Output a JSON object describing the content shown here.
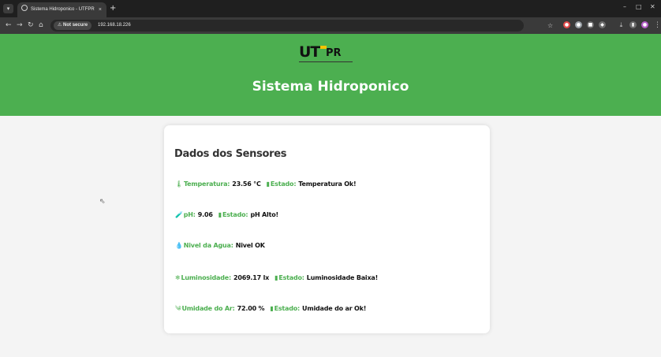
{
  "browser": {
    "tab_title": "Sistema Hidroponico - UTFPR",
    "tab_close": "×",
    "new_tab": "+",
    "security_label": "Not secure",
    "url": "192.168.18.226",
    "window_controls": [
      "–",
      "□",
      "✕"
    ]
  },
  "header": {
    "logo_main": "UT",
    "logo_pr": "PR",
    "title": "Sistema Hidroponico"
  },
  "card": {
    "title": "Dados dos Sensores",
    "rows": [
      {
        "icon": "🌡",
        "label": "Temperatura:",
        "value": "23.56 °C",
        "status_label": "Estado:",
        "status": "Temperatura Ok!"
      },
      {
        "icon": "🧪",
        "label": "pH:",
        "value": "9.06",
        "status_label": "Estado:",
        "status": "pH Alto!"
      },
      {
        "icon": "💧",
        "label": "Nivel da Agua:",
        "value": "Nivel OK"
      },
      {
        "icon": "❄",
        "label": "Luminosidade:",
        "value": "2069.17 lx",
        "status_label": "Estado:",
        "status": "Luminosidade Baixa!"
      },
      {
        "icon": "༄",
        "label": "Umidade do Ar:",
        "value": "72.00 %",
        "status_label": "Estado:",
        "status": "Umidade do ar Ok!"
      }
    ]
  },
  "colors": {
    "brand_green": "#4caf50",
    "page_bg": "#f4f4f4",
    "chrome_dark": "#1f1f1f"
  }
}
